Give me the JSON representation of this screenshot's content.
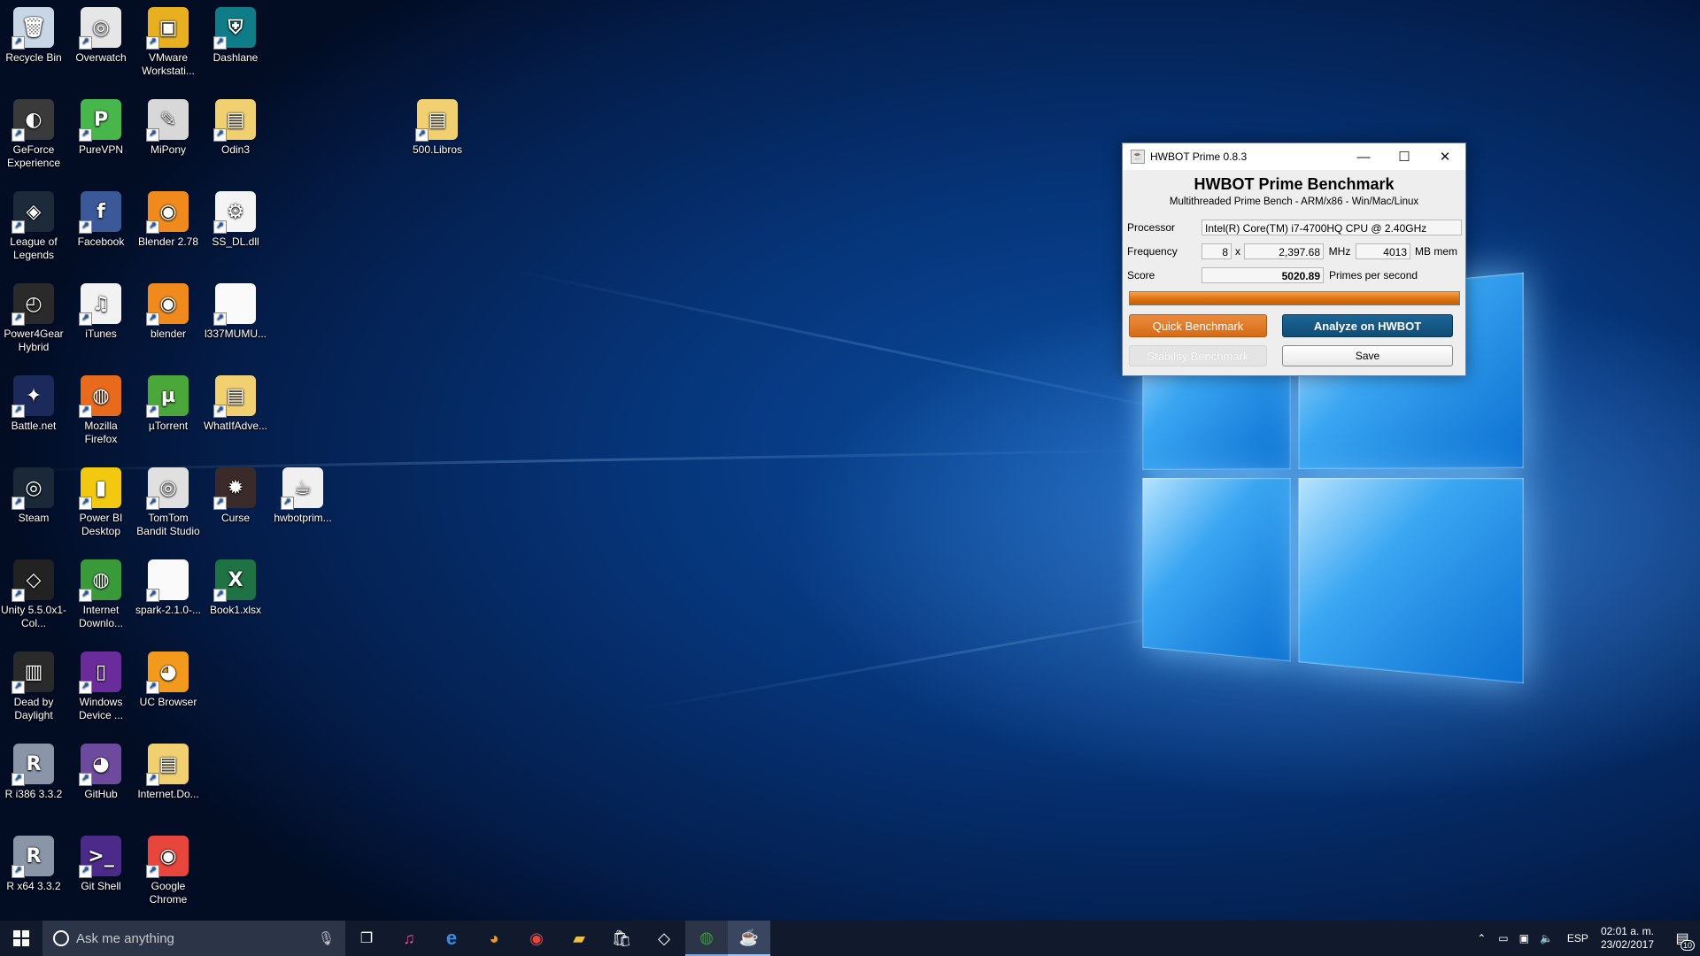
{
  "desktop": {
    "icons": [
      {
        "label": "Recycle Bin",
        "glyph": "🗑",
        "color": "#c8d6e6"
      },
      {
        "label": "Overwatch",
        "glyph": "◎",
        "color": "#e6e6e6"
      },
      {
        "label": "VMware Workstati...",
        "glyph": "▣",
        "color": "#e8b020"
      },
      {
        "label": "Dashlane",
        "glyph": "⛨",
        "color": "#0f7d88"
      },
      {
        "label": "GeForce Experience",
        "glyph": "◐",
        "color": "#3a3a3a"
      },
      {
        "label": "PureVPN",
        "glyph": "P",
        "color": "#47b64b"
      },
      {
        "label": "MiPony",
        "glyph": "✎",
        "color": "#d8d8d8"
      },
      {
        "label": "Odin3",
        "glyph": "▤",
        "color": "#f0d070"
      },
      {
        "label": "500.Libros",
        "glyph": "▤",
        "color": "#f0d070"
      },
      {
        "label": "League of Legends",
        "glyph": "◈",
        "color": "#1c2a3a"
      },
      {
        "label": "Facebook",
        "glyph": "f",
        "color": "#3b5998"
      },
      {
        "label": "Blender 2.78",
        "glyph": "◉",
        "color": "#f08a1c"
      },
      {
        "label": "SS_DL.dll",
        "glyph": "⚙",
        "color": "#f4f4f4"
      },
      {
        "label": "Power4Gear Hybrid",
        "glyph": "◴",
        "color": "#2a2a2a"
      },
      {
        "label": "iTunes",
        "glyph": "♫",
        "color": "#f2f2f2"
      },
      {
        "label": "blender",
        "glyph": "◉",
        "color": "#f08a1c"
      },
      {
        "label": "l337MUMU...",
        "glyph": "",
        "color": "#fafafa"
      },
      {
        "label": "Battle.net",
        "glyph": "✦",
        "color": "#1b2a5a"
      },
      {
        "label": "Mozilla Firefox",
        "glyph": "◍",
        "color": "#e86a1c"
      },
      {
        "label": "µTorrent",
        "glyph": "µ",
        "color": "#4aa83a"
      },
      {
        "label": "WhatIfAdve...",
        "glyph": "▤",
        "color": "#f0d070"
      },
      {
        "label": "Steam",
        "glyph": "◎",
        "color": "#1b2838"
      },
      {
        "label": "Power BI Desktop",
        "glyph": "▮",
        "color": "#f2c811"
      },
      {
        "label": "TomTom Bandit Studio",
        "glyph": "◎",
        "color": "#e0e0e0"
      },
      {
        "label": "Curse",
        "glyph": "✹",
        "color": "#3a2a2a"
      },
      {
        "label": "hwbotprim...",
        "glyph": "☕",
        "color": "#f0f0f0"
      },
      {
        "label": "Unity 5.5.0x1-Col...",
        "glyph": "◇",
        "color": "#222222"
      },
      {
        "label": "Internet Downlo...",
        "glyph": "◍",
        "color": "#3a9a3a"
      },
      {
        "label": "spark-2.1.0-...",
        "glyph": "",
        "color": "#fafafa"
      },
      {
        "label": "Book1.xlsx",
        "glyph": "X",
        "color": "#1f7244"
      },
      {
        "label": "Dead by Daylight",
        "glyph": "▥",
        "color": "#2a2a2a"
      },
      {
        "label": "Windows Device ...",
        "glyph": "▯",
        "color": "#6a2c9a"
      },
      {
        "label": "UC Browser",
        "glyph": "◕",
        "color": "#f39a1c"
      },
      {
        "label": "R i386 3.3.2",
        "glyph": "R",
        "color": "#8a96a8"
      },
      {
        "label": "GitHub",
        "glyph": "◕",
        "color": "#6e4a9e"
      },
      {
        "label": "Internet.Do...",
        "glyph": "▤",
        "color": "#f0d070"
      },
      {
        "label": "R x64 3.3.2",
        "glyph": "R",
        "color": "#8a96a8"
      },
      {
        "label": "Git Shell",
        "glyph": ">_",
        "color": "#4b2a8a"
      },
      {
        "label": "Google Chrome",
        "glyph": "◉",
        "color": "#e8453c"
      }
    ]
  },
  "window": {
    "title": "HWBOT Prime 0.8.3",
    "heading": "HWBOT Prime Benchmark",
    "subheading": "Multithreaded Prime Bench - ARM/x86 - Win/Mac/Linux",
    "processor_label": "Processor",
    "processor_value": "Intel(R) Core(TM) i7-4700HQ CPU @ 2.40GHz",
    "frequency_label": "Frequency",
    "cores_value": "8",
    "times_label": "x",
    "frequency_value": "2,397.68",
    "mhz_label": "MHz",
    "memory_value": "4013",
    "mem_label": "MB mem",
    "score_label": "Score",
    "score_value": "5020.89",
    "score_unit": "Primes per second",
    "progress": 1.0,
    "quick_benchmark": "Quick Benchmark",
    "analyze": "Analyze on HWBOT",
    "stability_benchmark": "Stability Benchmark",
    "save": "Save"
  },
  "taskbar": {
    "search_placeholder": "Ask me anything",
    "language": "ESP",
    "time": "02:01 a. m.",
    "date": "23/02/2017",
    "notification_count": "10"
  },
  "colors": {
    "accent_orange": "#e07414",
    "analyze_blue": "#0f4c75",
    "taskbar": "#101a2c"
  }
}
